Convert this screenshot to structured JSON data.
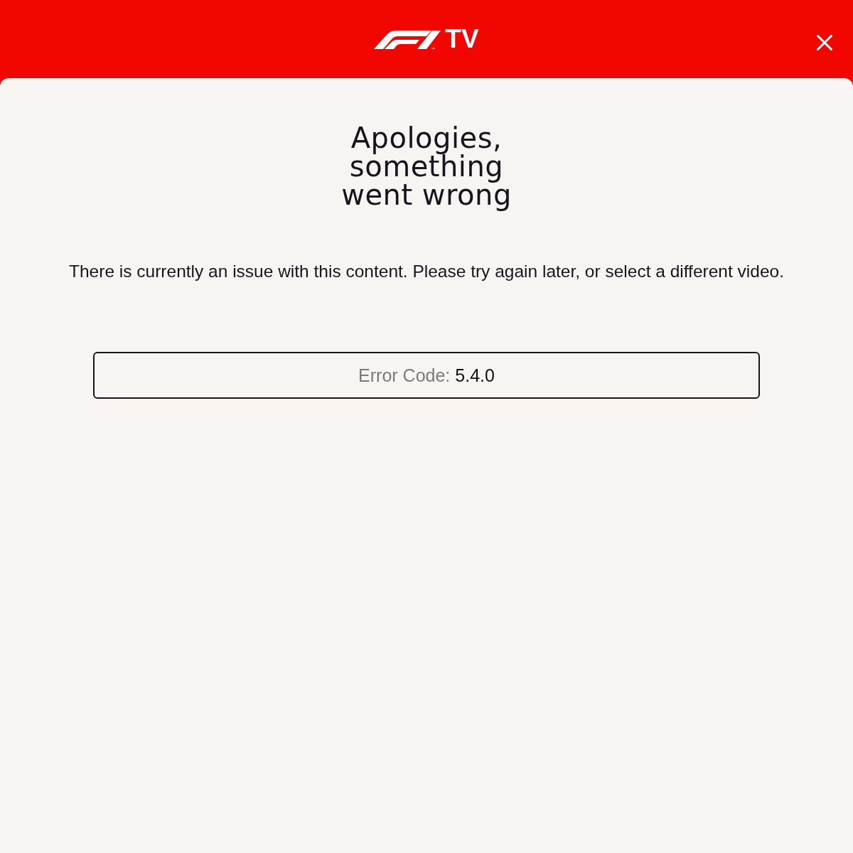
{
  "header": {
    "logo": {
      "text": "TV",
      "trademark": "™"
    }
  },
  "error_panel": {
    "title": "Apologies, something went wrong",
    "message": "There is currently an issue with this content. Please try again later, or select a different video.",
    "error_code": {
      "label": "Error Code:",
      "value": "5.4.0"
    }
  }
}
